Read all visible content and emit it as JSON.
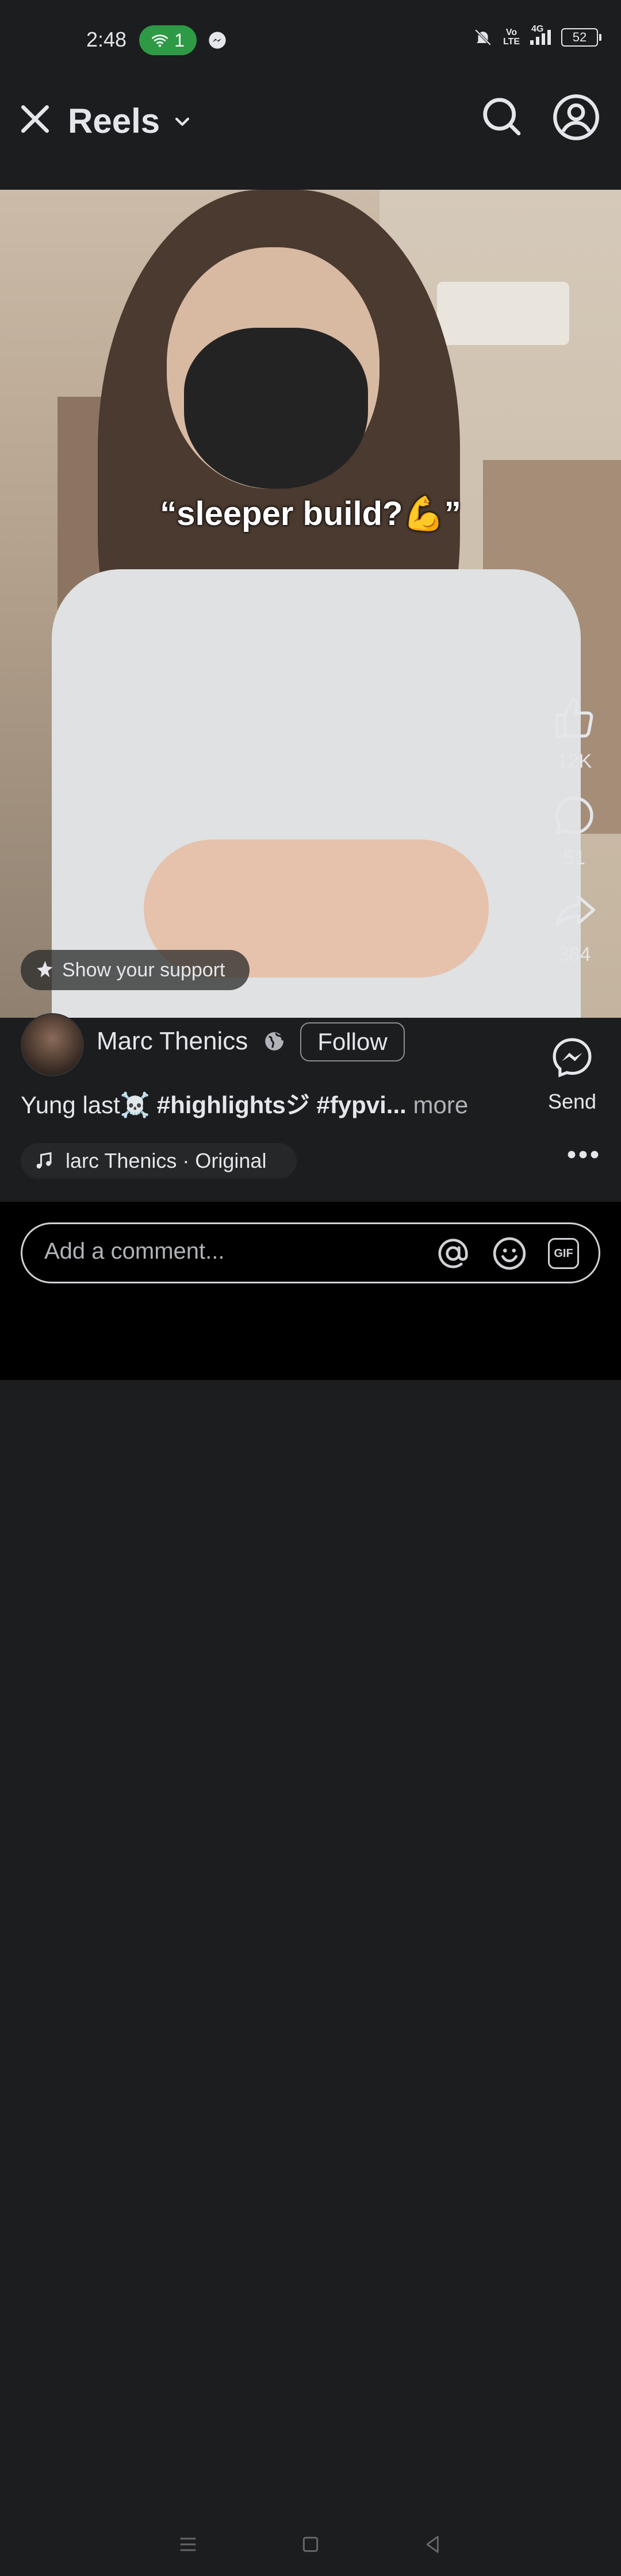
{
  "status_bar": {
    "time": "2:48",
    "hotspot_count": "1",
    "volte_top": "Vo",
    "volte_bottom": "LTE",
    "network": "4G",
    "battery": "52"
  },
  "header": {
    "title": "Reels"
  },
  "video": {
    "overlay_text": "“sleeper build?💪”"
  },
  "actions": {
    "likes": "12K",
    "comments": "51",
    "shares": "384",
    "send_label": "Send"
  },
  "support": {
    "label": "Show your support"
  },
  "post": {
    "author": "Marc Thenics",
    "follow_label": "Follow",
    "caption_text": "Yung last☠️ ",
    "caption_tags": "#highlightsジ #fypvi...",
    "caption_more": " more",
    "audio": "larc Thenics · Original"
  },
  "comment": {
    "placeholder": "Add a comment..."
  },
  "icons": {
    "close": "close-icon",
    "dropdown": "chevron-down-icon",
    "search": "search-icon",
    "profile": "profile-icon",
    "like": "thumbs-up-icon",
    "comment": "comment-icon",
    "share": "share-icon",
    "send": "messenger-icon",
    "more": "more-icon",
    "gif": "GIF"
  }
}
